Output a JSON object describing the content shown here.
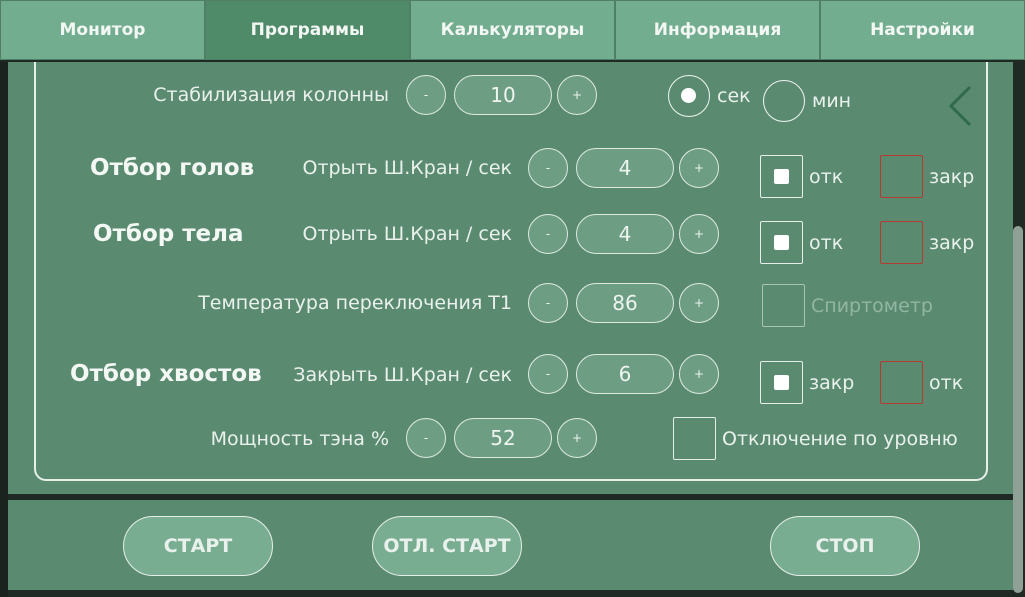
{
  "tabs": [
    {
      "label": "Монитор"
    },
    {
      "label": "Программы"
    },
    {
      "label": "Калькуляторы"
    },
    {
      "label": "Информация"
    },
    {
      "label": "Настройки"
    }
  ],
  "active_tab": "Программы",
  "column_stabilization": {
    "label": "Стабилизация колонны",
    "minus": "-",
    "value": "10",
    "plus": "+",
    "unit_sec": "сек",
    "unit_min": "мин",
    "selected_unit": "сек"
  },
  "heads": {
    "title": "Отбор голов",
    "label": "Отрыть Ш.Кран / сек",
    "minus": "-",
    "value": "4",
    "plus": "+",
    "open_label": "отк",
    "close_label": "закр",
    "open_checked": true,
    "close_checked": false
  },
  "body": {
    "title": "Отбор тела",
    "label": "Отрыть Ш.Кран / сек",
    "minus": "-",
    "value": "4",
    "plus": "+",
    "open_label": "отк",
    "close_label": "закр",
    "open_checked": true,
    "close_checked": false
  },
  "switch_temp": {
    "label": "Температура переключения Т1",
    "minus": "-",
    "value": "86",
    "plus": "+",
    "checkbox_label": "Спиртометр",
    "checked": false
  },
  "tails": {
    "title": "Отбор хвостов",
    "label": "Закрыть Ш.Кран / сек",
    "minus": "-",
    "value": "6",
    "plus": "+",
    "close_label": "закр",
    "open_label": "отк",
    "close_checked": true,
    "open_checked": false
  },
  "heater_power": {
    "label": "Мощность тэна %",
    "minus": "-",
    "value": "52",
    "plus": "+",
    "checkbox_label": "Отключение по уровню",
    "checked": false
  },
  "buttons": {
    "start": "СТАРТ",
    "delayed_start": "ОТЛ. СТАРТ",
    "stop": "СТОП"
  },
  "colors": {
    "tab_bg": "#73ad90",
    "tab_active_bg": "#4f8a69",
    "panel_bg": "#5a8b71",
    "danger_border": "#b73a32"
  }
}
